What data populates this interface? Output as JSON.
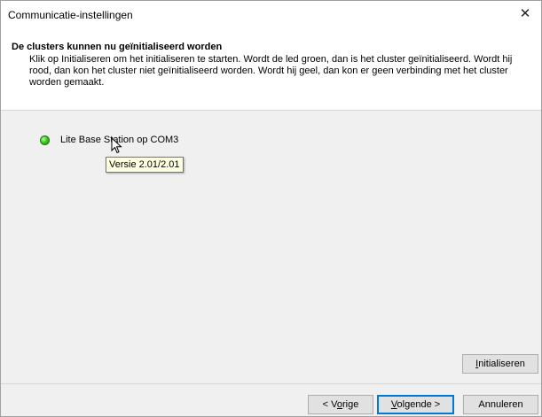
{
  "window": {
    "title": "Communicatie-instellingen",
    "close_glyph": "✕"
  },
  "header": {
    "title": "De clusters kunnen nu geïnitialiseerd worden",
    "description": "Klik op Initialiseren om het initialiseren te starten. Wordt de led groen, dan is het cluster geïnitialiseerd. Wordt hij rood, dan kon het cluster niet geïnitialiseerd worden. Wordt hij geel, dan kon er geen verbinding met het cluster worden gemaakt."
  },
  "clusters": [
    {
      "label": "Lite Base Station op COM3",
      "led_status": "green",
      "led_color": "#3dcb22",
      "tooltip": "Versie 2.01/2.01"
    }
  ],
  "buttons": {
    "initialize": {
      "prefix": "",
      "underlined": "I",
      "suffix": "nitialiseren"
    },
    "previous": {
      "prefix": "< V",
      "underlined": "o",
      "suffix": "rige"
    },
    "next": {
      "prefix": "",
      "underlined": "V",
      "suffix": "olgende >"
    },
    "cancel": {
      "label": "Annuleren"
    }
  },
  "colors": {
    "tooltip_bg": "#ffffe1",
    "focus_border": "#0078d7"
  }
}
